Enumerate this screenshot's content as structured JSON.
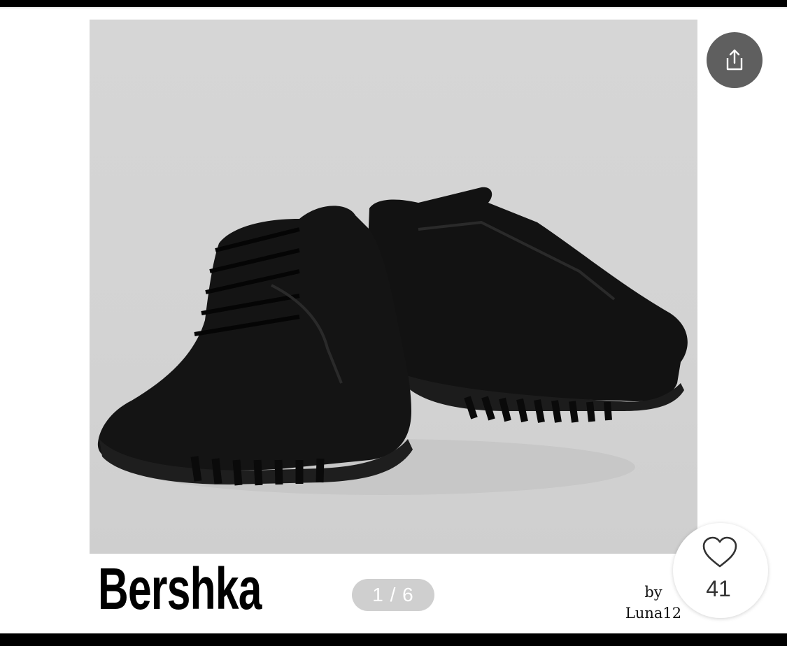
{
  "listing": {
    "brand": "Bershka",
    "image_counter": "1 / 6",
    "author_by": "by",
    "author_name": "Luna12",
    "like_count": "41"
  },
  "icons": {
    "share": "share-icon",
    "like": "heart-icon"
  },
  "colors": {
    "share_button_bg": "#5f5f5f",
    "photo_bg": "#d4d4d4",
    "pager_bg": "#cfcfcf"
  }
}
